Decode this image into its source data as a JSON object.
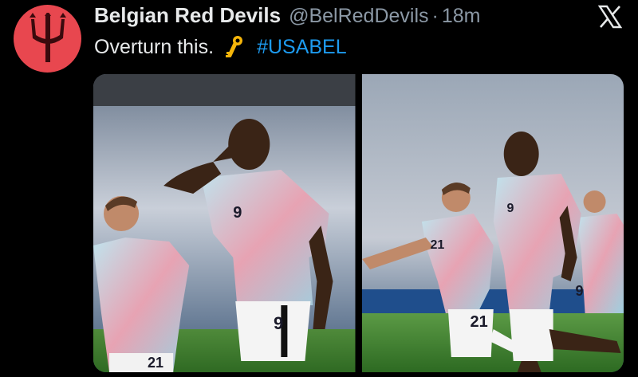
{
  "tweet": {
    "author_name": "Belgian Red Devils",
    "handle": "@BelRedDevils",
    "separator": "·",
    "timestamp": "18m",
    "text": "Overturn this.",
    "hashtag": "#USABEL"
  },
  "icons": {
    "avatar": "trident-logo",
    "platform": "x-logo",
    "emoji": "key-emoji"
  },
  "media": {
    "photos": [
      {
        "jersey_numbers": [
          "21",
          "9"
        ]
      },
      {
        "jersey_numbers": [
          "21",
          "9",
          "21",
          "9"
        ]
      }
    ]
  },
  "colors": {
    "avatar_bg": "#e8474f",
    "hashtag": "#1d9bf0",
    "text": "#e7e9ea",
    "muted": "#8b98a5"
  }
}
